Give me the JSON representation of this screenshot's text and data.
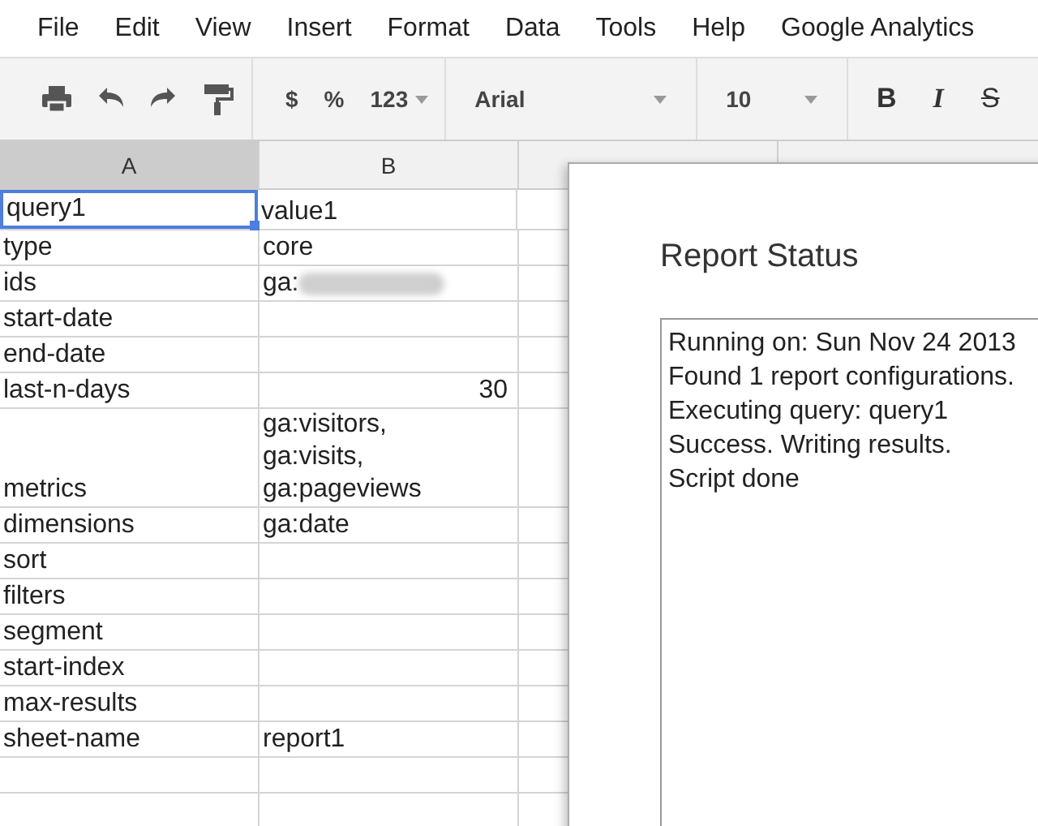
{
  "menu": [
    "File",
    "Edit",
    "View",
    "Insert",
    "Format",
    "Data",
    "Tools",
    "Help",
    "Google Analytics"
  ],
  "toolbar": {
    "format_buttons": [
      "$",
      "%"
    ],
    "number_format": "123",
    "font": "Arial",
    "font_size": "10",
    "style_buttons": [
      {
        "label": "B",
        "kind": "bold"
      },
      {
        "label": "I",
        "kind": "italic"
      },
      {
        "label": "S",
        "kind": "strike"
      }
    ]
  },
  "columns": [
    {
      "label": "A",
      "selected": true
    },
    {
      "label": "B",
      "selected": false
    }
  ],
  "rows": [
    {
      "cells": [
        {
          "text": "query1",
          "selected": true
        },
        {
          "text": "value1",
          "selected": false
        }
      ]
    },
    {
      "cells": [
        {
          "text": "type",
          "selected": false
        },
        {
          "text": "core",
          "selected": false
        }
      ]
    },
    {
      "cells": [
        {
          "text": "ids",
          "selected": false
        },
        {
          "text": "ga:",
          "selected": false,
          "redacted": true
        }
      ]
    },
    {
      "cells": [
        {
          "text": "start-date",
          "selected": false
        },
        {
          "selected": false
        }
      ]
    },
    {
      "cells": [
        {
          "text": "end-date",
          "selected": false
        },
        {
          "selected": false
        }
      ]
    },
    {
      "cells": [
        {
          "text": "last-n-days",
          "selected": false
        },
        {
          "text": "30",
          "selected": false,
          "kind": "number"
        }
      ]
    },
    {
      "cells": [
        {
          "text": "metrics",
          "selected": false
        },
        {
          "text": "ga:visitors,\nga:visits,\nga:pageviews",
          "selected": false
        }
      ]
    },
    {
      "cells": [
        {
          "text": "dimensions",
          "selected": false
        },
        {
          "text": "ga:date",
          "selected": false
        }
      ]
    },
    {
      "cells": [
        {
          "text": "sort",
          "selected": false
        },
        {
          "selected": false
        }
      ]
    },
    {
      "cells": [
        {
          "text": "filters",
          "selected": false
        },
        {
          "selected": false
        }
      ]
    },
    {
      "cells": [
        {
          "text": "segment",
          "selected": false
        },
        {
          "selected": false
        }
      ]
    },
    {
      "cells": [
        {
          "text": "start-index",
          "selected": false
        },
        {
          "selected": false
        }
      ]
    },
    {
      "cells": [
        {
          "text": "max-results",
          "selected": false
        },
        {
          "selected": false
        }
      ]
    },
    {
      "cells": [
        {
          "text": "sheet-name",
          "selected": false
        },
        {
          "text": "report1",
          "selected": false
        }
      ]
    },
    {
      "cells": [
        {
          "selected": false
        },
        {
          "selected": false
        }
      ]
    },
    {
      "cells": [
        {
          "selected": false
        },
        {
          "selected": false
        }
      ]
    }
  ],
  "dialog": {
    "title": "Report Status",
    "log": [
      "Running on: Sun Nov 24 2013",
      "Found 1 report configurations.",
      "Executing query: query1",
      "Success. Writing results.",
      "Script done"
    ]
  }
}
